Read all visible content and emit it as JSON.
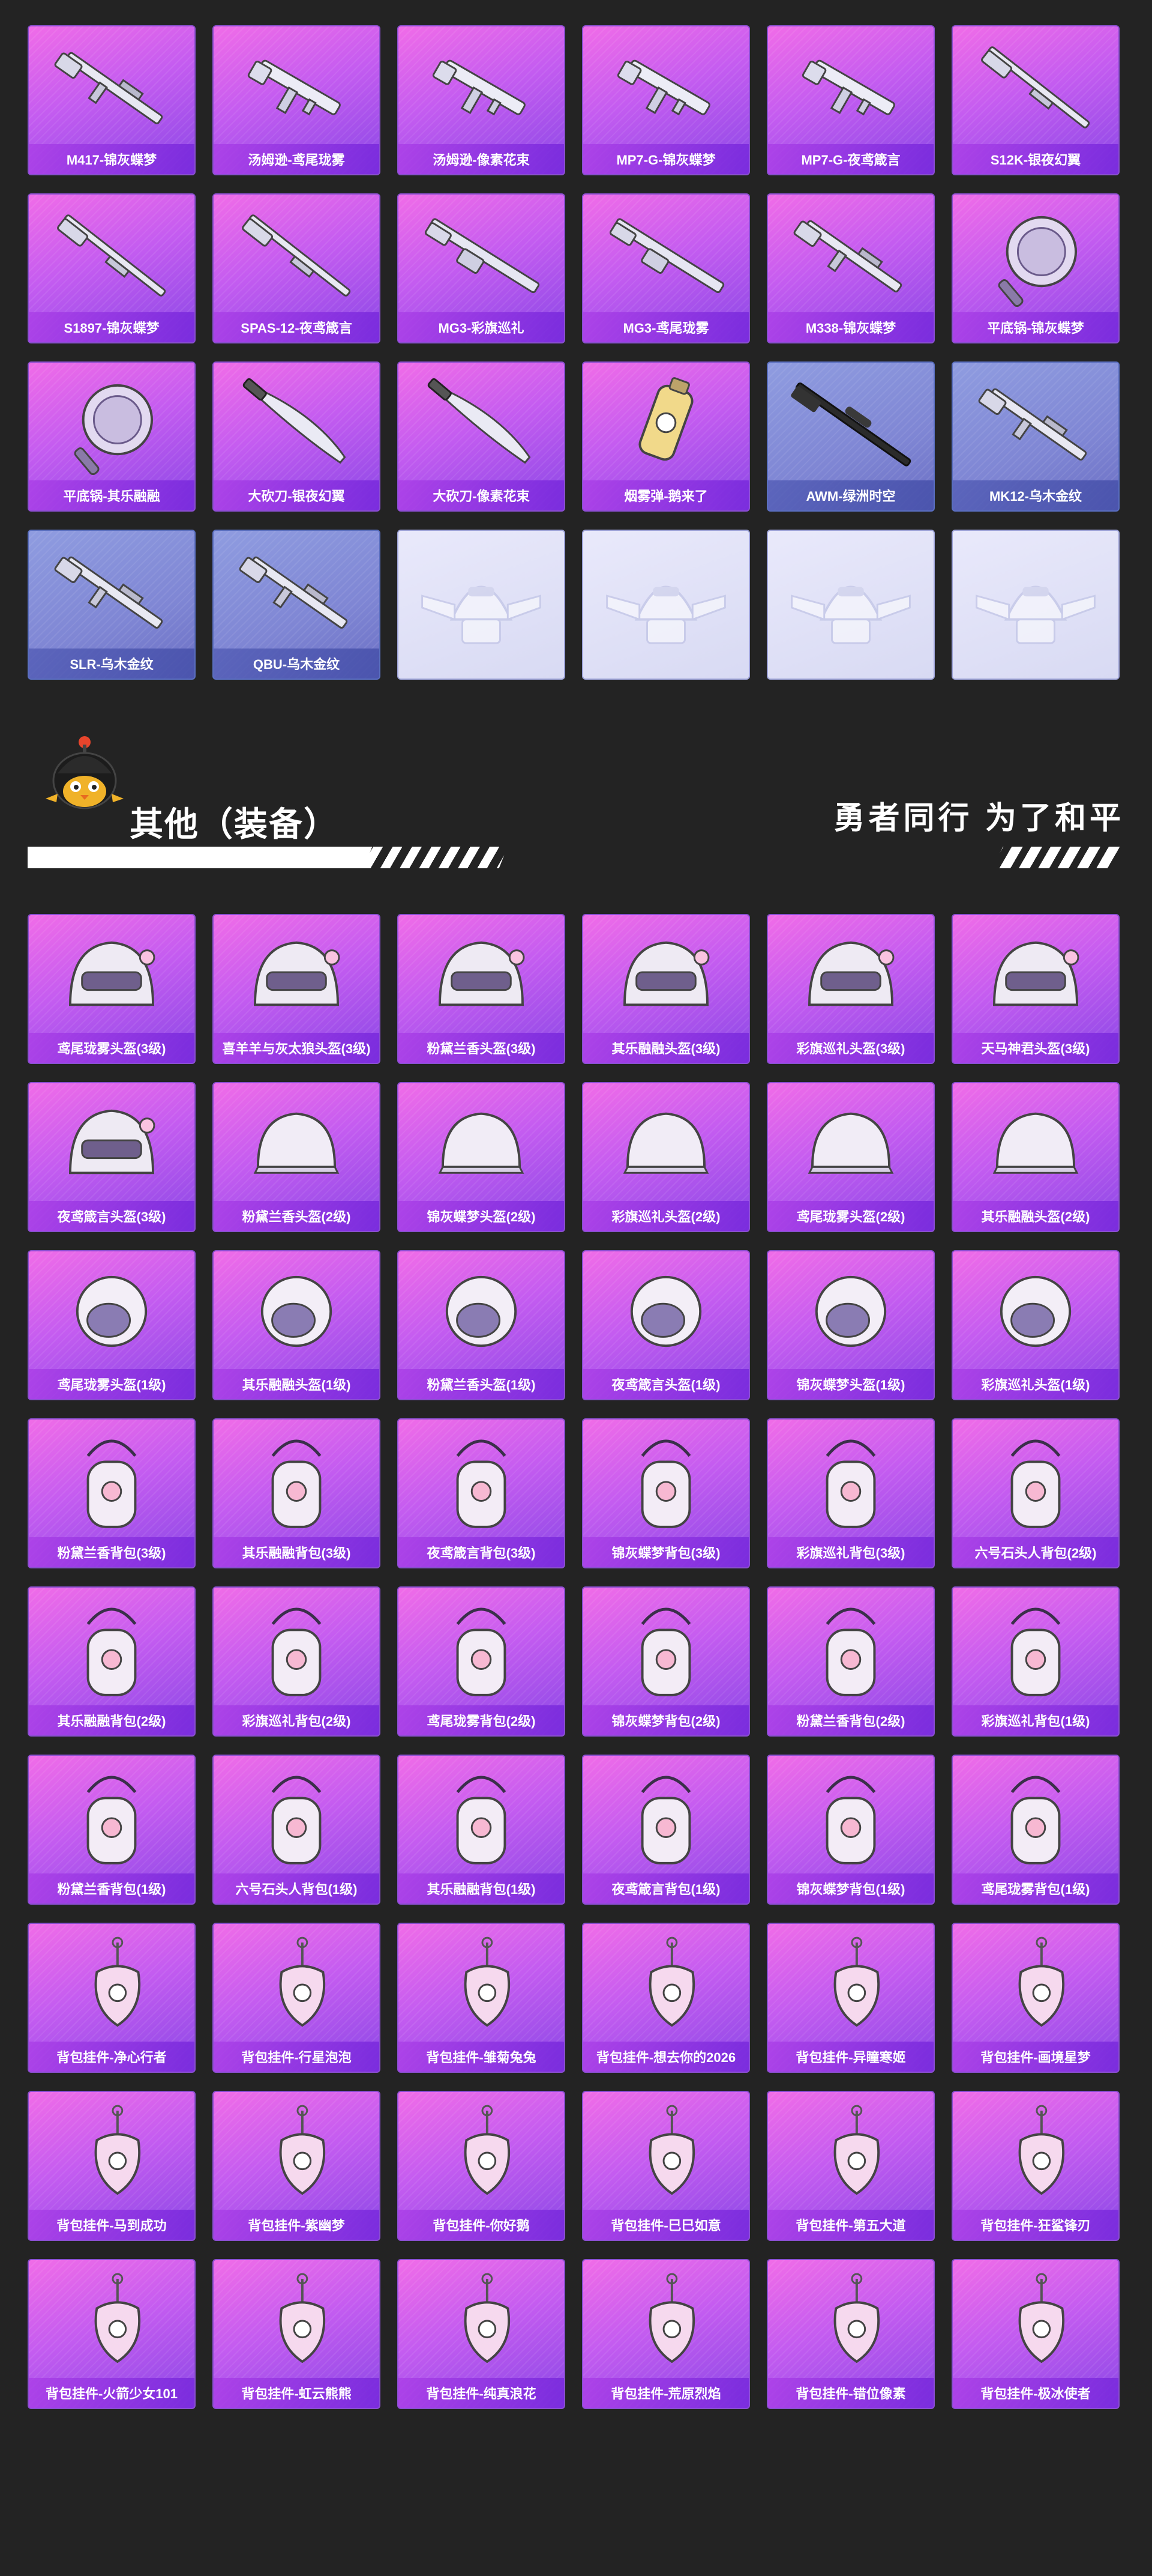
{
  "weapons": [
    {
      "label": "M417-锦灰蝶梦",
      "type": "rifle",
      "tint": "pink"
    },
    {
      "label": "汤姆逊-鸢尾珑雾",
      "type": "smg",
      "tint": "pink"
    },
    {
      "label": "汤姆逊-像素花束",
      "type": "smg",
      "tint": "pink"
    },
    {
      "label": "MP7-G-锦灰蝶梦",
      "type": "smg",
      "tint": "pink"
    },
    {
      "label": "MP7-G-夜鸢箴言",
      "type": "smg",
      "tint": "pink"
    },
    {
      "label": "S12K-银夜幻翼",
      "type": "shotgun",
      "tint": "pink"
    },
    {
      "label": "S1897-锦灰蝶梦",
      "type": "shotgun",
      "tint": "pink"
    },
    {
      "label": "SPAS-12-夜鸢箴言",
      "type": "shotgun",
      "tint": "pink"
    },
    {
      "label": "MG3-彩旗巡礼",
      "type": "lmg",
      "tint": "pink"
    },
    {
      "label": "MG3-鸢尾珑雾",
      "type": "lmg",
      "tint": "pink"
    },
    {
      "label": "M338-锦灰蝶梦",
      "type": "rifle",
      "tint": "pink"
    },
    {
      "label": "平底锅-锦灰蝶梦",
      "type": "pan",
      "tint": "pink"
    },
    {
      "label": "平底锅-其乐融融",
      "type": "pan",
      "tint": "pink"
    },
    {
      "label": "大砍刀-银夜幻翼",
      "type": "machete",
      "tint": "pink"
    },
    {
      "label": "大砍刀-像素花束",
      "type": "machete",
      "tint": "pink"
    },
    {
      "label": "烟雾弹-鹅来了",
      "type": "grenade",
      "tint": "pink"
    },
    {
      "label": "AWM-绿洲时空",
      "type": "sniper",
      "tint": "blue"
    },
    {
      "label": "MK12-乌木金纹",
      "type": "rifle",
      "tint": "blue"
    },
    {
      "label": "SLR-乌木金纹",
      "type": "rifle",
      "tint": "blue"
    },
    {
      "label": "QBU-乌木金纹",
      "type": "rifle",
      "tint": "blue"
    },
    {
      "label": "",
      "type": "placeholder",
      "tint": "empty"
    },
    {
      "label": "",
      "type": "placeholder",
      "tint": "empty"
    },
    {
      "label": "",
      "type": "placeholder",
      "tint": "empty"
    },
    {
      "label": "",
      "type": "placeholder",
      "tint": "empty"
    }
  ],
  "section": {
    "title": "其他（装备）",
    "slogan": "勇者同行 为了和平"
  },
  "equipment": [
    {
      "label": "鸢尾珑雾头盔(3级)",
      "type": "helmet3"
    },
    {
      "label": "喜羊羊与灰太狼头盔(3级)",
      "type": "helmet3"
    },
    {
      "label": "粉黛兰香头盔(3级)",
      "type": "helmet3"
    },
    {
      "label": "其乐融融头盔(3级)",
      "type": "helmet3"
    },
    {
      "label": "彩旗巡礼头盔(3级)",
      "type": "helmet3"
    },
    {
      "label": "天马神君头盔(3级)",
      "type": "helmet3"
    },
    {
      "label": "夜鸢箴言头盔(3级)",
      "type": "helmet3"
    },
    {
      "label": "粉黛兰香头盔(2级)",
      "type": "helmet2"
    },
    {
      "label": "锦灰蝶梦头盔(2级)",
      "type": "helmet2"
    },
    {
      "label": "彩旗巡礼头盔(2级)",
      "type": "helmet2"
    },
    {
      "label": "鸢尾珑雾头盔(2级)",
      "type": "helmet2"
    },
    {
      "label": "其乐融融头盔(2级)",
      "type": "helmet2"
    },
    {
      "label": "鸢尾珑雾头盔(1级)",
      "type": "helmet1"
    },
    {
      "label": "其乐融融头盔(1级)",
      "type": "helmet1"
    },
    {
      "label": "粉黛兰香头盔(1级)",
      "type": "helmet1"
    },
    {
      "label": "夜鸢箴言头盔(1级)",
      "type": "helmet1"
    },
    {
      "label": "锦灰蝶梦头盔(1级)",
      "type": "helmet1"
    },
    {
      "label": "彩旗巡礼头盔(1级)",
      "type": "helmet1"
    },
    {
      "label": "粉黛兰香背包(3级)",
      "type": "bag"
    },
    {
      "label": "其乐融融背包(3级)",
      "type": "bag"
    },
    {
      "label": "夜鸢箴言背包(3级)",
      "type": "bag"
    },
    {
      "label": "锦灰蝶梦背包(3级)",
      "type": "bag"
    },
    {
      "label": "彩旗巡礼背包(3级)",
      "type": "bag"
    },
    {
      "label": "六号石头人背包(2级)",
      "type": "bag"
    },
    {
      "label": "其乐融融背包(2级)",
      "type": "bag"
    },
    {
      "label": "彩旗巡礼背包(2级)",
      "type": "bag"
    },
    {
      "label": "鸢尾珑雾背包(2级)",
      "type": "bag"
    },
    {
      "label": "锦灰蝶梦背包(2级)",
      "type": "bag"
    },
    {
      "label": "粉黛兰香背包(2级)",
      "type": "bag"
    },
    {
      "label": "彩旗巡礼背包(1级)",
      "type": "bag"
    },
    {
      "label": "粉黛兰香背包(1级)",
      "type": "bag"
    },
    {
      "label": "六号石头人背包(1级)",
      "type": "bag"
    },
    {
      "label": "其乐融融背包(1级)",
      "type": "bag"
    },
    {
      "label": "夜鸢箴言背包(1级)",
      "type": "bag"
    },
    {
      "label": "锦灰蝶梦背包(1级)",
      "type": "bag"
    },
    {
      "label": "鸢尾珑雾背包(1级)",
      "type": "bag"
    },
    {
      "label": "背包挂件-净心行者",
      "type": "charm"
    },
    {
      "label": "背包挂件-行星泡泡",
      "type": "charm"
    },
    {
      "label": "背包挂件-雏菊兔兔",
      "type": "charm"
    },
    {
      "label": "背包挂件-想去你的2026",
      "type": "charm"
    },
    {
      "label": "背包挂件-异瞳寒姬",
      "type": "charm"
    },
    {
      "label": "背包挂件-画境星梦",
      "type": "charm"
    },
    {
      "label": "背包挂件-马到成功",
      "type": "charm"
    },
    {
      "label": "背包挂件-紫幽梦",
      "type": "charm"
    },
    {
      "label": "背包挂件-你好鹅",
      "type": "charm"
    },
    {
      "label": "背包挂件-巳巳如意",
      "type": "charm"
    },
    {
      "label": "背包挂件-第五大道",
      "type": "charm"
    },
    {
      "label": "背包挂件-狂鲨锋刃",
      "type": "charm"
    },
    {
      "label": "背包挂件-火箭少女101",
      "type": "charm"
    },
    {
      "label": "背包挂件-虹云熊熊",
      "type": "charm"
    },
    {
      "label": "背包挂件-纯真浪花",
      "type": "charm"
    },
    {
      "label": "背包挂件-荒原烈焰",
      "type": "charm"
    },
    {
      "label": "背包挂件-错位像素",
      "type": "charm"
    },
    {
      "label": "背包挂件-极冰使者",
      "type": "charm"
    }
  ]
}
